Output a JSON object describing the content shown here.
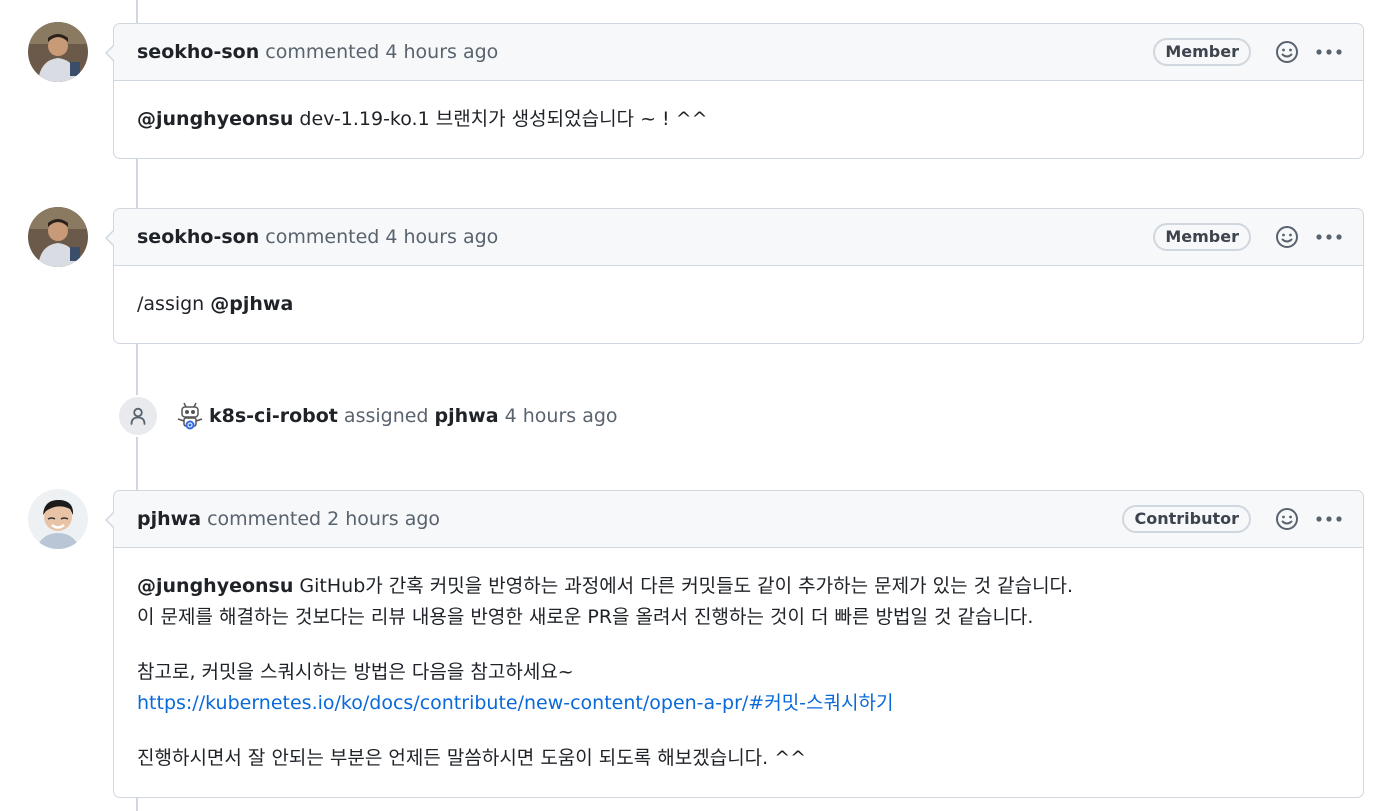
{
  "comments": [
    {
      "author": "seokho-son",
      "action": "commented",
      "time": "4 hours ago",
      "role": "Member",
      "mention": "@junghyeonsu",
      "text": " dev-1.19-ko.1 브랜치가 생성되었습니다 ~ ! ^^"
    },
    {
      "author": "seokho-son",
      "action": "commented",
      "time": "4 hours ago",
      "role": "Member",
      "prefix": "/assign ",
      "mention": "@pjhwa"
    },
    {
      "author": "pjhwa",
      "action": "commented",
      "time": "2 hours ago",
      "role": "Contributor",
      "mention": "@junghyeonsu",
      "line1": " GitHub가 간혹 커밋을 반영하는 과정에서 다른 커밋들도 같이 추가하는 문제가 있는 것 같습니다.",
      "line2": "이 문제를 해결하는 것보다는 리뷰 내용을 반영한 새로운 PR을 올려서 진행하는 것이 더 빠른 방법일 것 같습니다.",
      "para2_line1": "참고로, 커밋을 스쿼시하는 방법은 다음을 참고하세요~",
      "link": "https://kubernetes.io/ko/docs/contribute/new-content/open-a-pr/#커밋-스쿼시하기",
      "para3": "진행하시면서 잘 안되는 부분은 언제든 말씀하시면 도움이 되도록 해보겠습니다. ^^"
    }
  ],
  "event": {
    "actor": "k8s-ci-robot",
    "action": "assigned",
    "target": "pjhwa",
    "time": "4 hours ago"
  },
  "icons": {
    "reaction": "smiley-icon",
    "menu": "kebab-menu-icon",
    "assign": "person-icon"
  },
  "colors": {
    "link": "#0969da",
    "border": "#d0d7de",
    "header_bg": "#f6f8fa"
  }
}
